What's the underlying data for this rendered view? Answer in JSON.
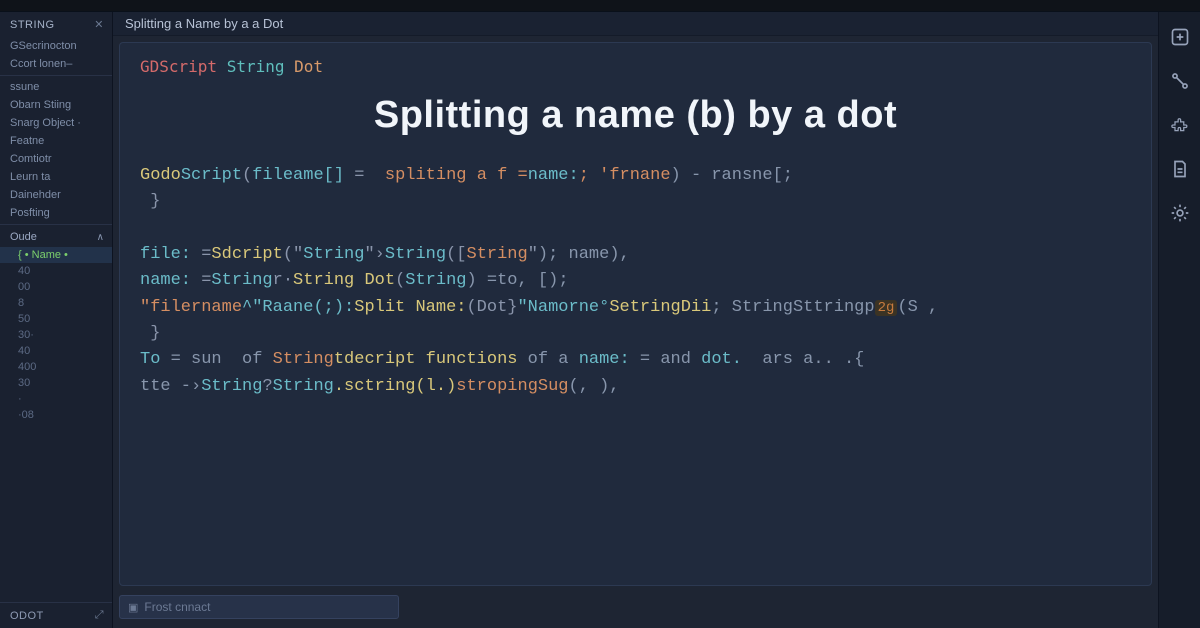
{
  "tab_title": "Splitting a Name by a a Dot",
  "tags": {
    "a": "GDScript",
    "b": "String",
    "c": "Dot"
  },
  "heading": "Splitting a name (b) by a dot",
  "sidebar": {
    "header": "STRING",
    "header_icon": "✕",
    "items": [
      "GSecrinocton",
      "Ccort lonen–",
      "ssune",
      "Obarn Stiing",
      "Snarg Object ·",
      "Featne",
      "Comtiotr",
      "Leurn ta",
      "Dainehder",
      "Posfting"
    ],
    "tree_header": "Oude",
    "tree_items": [
      "{ • Name •",
      "40",
      "00",
      "8",
      "50",
      "30·",
      "40",
      "400",
      "30",
      "·",
      "·08"
    ],
    "footer": "ODOT",
    "footer_icon": "⤢"
  },
  "code": {
    "l1a": "Godo",
    "l1b": "Script",
    "l1c": "(",
    "l1d": "fileame[]",
    "l1e": " = ",
    "l1f": " spliting a f =",
    "l1g": "name:",
    "l1h": "; 'frnane",
    "l1i": ") - ransne[;",
    "l2": " }",
    "l3a": "file:",
    "l3b": " =",
    "l3c": "Sdcript",
    "l3d": "(\"",
    "l3e": "String",
    "l3f": "\"›",
    "l3g": "String",
    "l3h": "([",
    "l3i": "String",
    "l3j": "\"",
    "l3k": "); name),",
    "l4a": "name:",
    "l4b": " =",
    "l4c": "String",
    "l4d": "r·",
    "l4e": "String Dot",
    "l4f": "(",
    "l4g": "String",
    "l4h": ") =to, [);",
    "l5a": "\"filername",
    "l5b": "^\"Raane(;):",
    "l5c": "Split Name:",
    "l5d": "(Dot}",
    "l5e": "\"Namorne°",
    "l5f": "SetringDii",
    "l5g": "; StringSttringp",
    "l5h": "2g",
    "l5i": "(S ,",
    "l6": " }",
    "l7a": "To",
    "l7b": " = sun  of ",
    "l7c": "String",
    "l7d": "tdecript functions",
    "l7e": " of a ",
    "l7f": "name:",
    "l7g": " = and ",
    "l7h": "dot.",
    "l7i": "  ars a.. .{",
    "l8a": "tte -›",
    "l8b": "String",
    "l8c": "?",
    "l8d": "String",
    "l8e": ".sctring(l.)",
    "l8f": "stropingSug",
    "l8g": "(, ),"
  },
  "input": {
    "icon": "▣",
    "placeholder": "Frost cnnact"
  },
  "rail": {
    "i1": "square-plus-icon",
    "i2": "path-icon",
    "i3": "puzzle-icon",
    "i4": "document-icon",
    "i5": "gear-icon"
  }
}
